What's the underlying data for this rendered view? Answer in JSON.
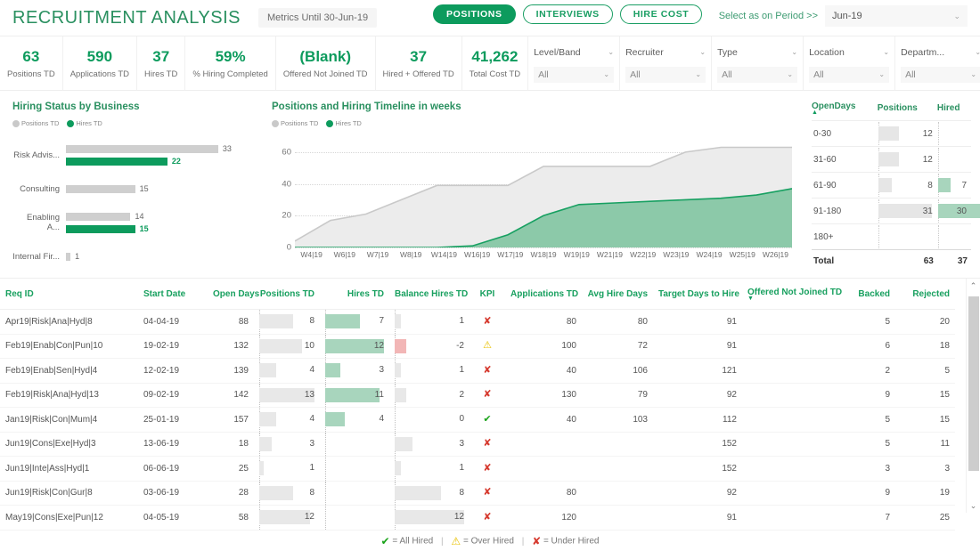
{
  "header": {
    "title": "RECRUITMENT ANALYSIS",
    "metrics_chip": "Metrics Until 30-Jun-19",
    "tabs": [
      {
        "label": "POSITIONS",
        "active": true
      },
      {
        "label": "INTERVIEWS",
        "active": false
      },
      {
        "label": "HIRE COST",
        "active": false
      }
    ],
    "period_label": "Select as on Period >>",
    "period_value": "Jun-19",
    "period_icon": "chevron-down-icon"
  },
  "kpis": [
    {
      "value": "63",
      "label": "Positions TD"
    },
    {
      "value": "590",
      "label": "Applications TD"
    },
    {
      "value": "37",
      "label": "Hires TD"
    },
    {
      "value": "59%",
      "label": "% Hiring Completed"
    },
    {
      "value": "(Blank)",
      "label": "Offered Not Joined TD"
    },
    {
      "value": "37",
      "label": "Hired + Offered TD"
    },
    {
      "value": "41,262",
      "label": "Total Cost TD"
    }
  ],
  "filters": [
    {
      "name": "Level/Band",
      "value": "All"
    },
    {
      "name": "Recruiter",
      "value": "All"
    },
    {
      "name": "Type",
      "value": "All"
    },
    {
      "name": "Location",
      "value": "All"
    },
    {
      "name": "Departm...",
      "value": "All"
    }
  ],
  "colors": {
    "brand_green": "#0d9b5d",
    "title_green": "#2a9060",
    "header_green": "#18a05f",
    "bar_gray": "#cfcfcf",
    "fill_green": "#a8d5bd",
    "fill_red": "#f2b6b6"
  },
  "chart_data": [
    {
      "type": "bar",
      "title": "Hiring Status by Business",
      "orientation": "horizontal",
      "legend": [
        "Positions TD",
        "Hires TD"
      ],
      "legend_position": "top-left",
      "categories": [
        "Risk Advis...",
        "Consulting",
        "Enabling A...",
        "Internal Fir..."
      ],
      "series": [
        {
          "name": "Positions TD",
          "values": [
            33,
            15,
            14,
            1
          ],
          "color": "#cfcfcf"
        },
        {
          "name": "Hires TD",
          "values": [
            22,
            null,
            15,
            null
          ],
          "color": "#0d9b5d"
        }
      ],
      "xlabel": "",
      "ylabel": "",
      "grid": false
    },
    {
      "type": "area",
      "title": "Positions and Hiring Timeline in weeks",
      "legend": [
        "Positions TD",
        "Hires TD"
      ],
      "legend_position": "top-left",
      "x": [
        "W4|19",
        "W6|19",
        "W7|19",
        "W8|19",
        "W14|19",
        "W16|19",
        "W17|19",
        "W18|19",
        "W19|19",
        "W21|19",
        "W22|19",
        "W23|19",
        "W24|19",
        "W25|19",
        "W26|19"
      ],
      "series": [
        {
          "name": "Positions TD",
          "values": [
            4,
            17,
            21,
            30,
            39,
            39,
            39,
            51,
            51,
            51,
            51,
            60,
            63,
            63,
            63
          ],
          "color": "#e8e8e8"
        },
        {
          "name": "Hires TD",
          "values": [
            0,
            0,
            0,
            0,
            0,
            1,
            8,
            20,
            27,
            28,
            29,
            30,
            31,
            33,
            37
          ],
          "color": "#7cc1a0"
        }
      ],
      "ylim": [
        0,
        70
      ],
      "yticks": [
        0,
        20,
        40,
        60
      ],
      "xlabel": "",
      "ylabel": "",
      "grid": true
    },
    {
      "type": "table",
      "title": "OpenDays matrix",
      "columns": [
        "OpenDays",
        "Positions",
        "Hired"
      ],
      "sort_column": "OpenDays",
      "sort_direction": "asc",
      "rows": [
        {
          "bucket": "0-30",
          "positions": "12",
          "hired": ""
        },
        {
          "bucket": "31-60",
          "positions": "12",
          "hired": ""
        },
        {
          "bucket": "61-90",
          "positions": "8",
          "hired": "7"
        },
        {
          "bucket": "91-180",
          "positions": "31",
          "hired": "30"
        },
        {
          "bucket": "180+",
          "positions": "",
          "hired": ""
        }
      ],
      "total_row": {
        "bucket": "Total",
        "positions": "63",
        "hired": "37"
      },
      "positions_max": 31,
      "hired_max": 30
    }
  ],
  "table": {
    "columns": [
      {
        "key": "req_id",
        "label": "Req ID",
        "align": "l"
      },
      {
        "key": "start_date",
        "label": "Start Date",
        "align": "l"
      },
      {
        "key": "open_days",
        "label": "Open Days",
        "align": "r"
      },
      {
        "key": "positions",
        "label": "Positions TD",
        "align": "r"
      },
      {
        "key": "hires",
        "label": "Hires TD",
        "align": "r"
      },
      {
        "key": "balance",
        "label": "Balance Hires TD",
        "align": "r"
      },
      {
        "key": "kpi",
        "label": "KPI",
        "align": "c"
      },
      {
        "key": "apps",
        "label": "Applications TD",
        "align": "r"
      },
      {
        "key": "avg_hire",
        "label": "Avg Hire Days",
        "align": "r"
      },
      {
        "key": "target",
        "label": "Target Days to Hire",
        "align": "r"
      },
      {
        "key": "onj",
        "label": "Offered Not Joined TD",
        "align": "r"
      },
      {
        "key": "backed",
        "label": "Backed",
        "align": "r"
      },
      {
        "key": "rejected",
        "label": "Rejected",
        "align": "r"
      }
    ],
    "sort_column": "Offered Not Joined TD",
    "rows": [
      {
        "req_id": "Apr19|Risk|Ana|Hyd|8",
        "start_date": "04-04-19",
        "open_days": "88",
        "positions": "8",
        "hires": "7",
        "balance": "1",
        "kpi": "under",
        "apps": "80",
        "avg_hire": "80",
        "target": "91",
        "onj": "",
        "backed": "5",
        "rejected": "20"
      },
      {
        "req_id": "Feb19|Enab|Con|Pun|10",
        "start_date": "19-02-19",
        "open_days": "132",
        "positions": "10",
        "hires": "12",
        "balance": "-2",
        "kpi": "over",
        "apps": "100",
        "avg_hire": "72",
        "target": "91",
        "onj": "",
        "backed": "6",
        "rejected": "18"
      },
      {
        "req_id": "Feb19|Enab|Sen|Hyd|4",
        "start_date": "12-02-19",
        "open_days": "139",
        "positions": "4",
        "hires": "3",
        "balance": "1",
        "kpi": "under",
        "apps": "40",
        "avg_hire": "106",
        "target": "121",
        "onj": "",
        "backed": "2",
        "rejected": "5"
      },
      {
        "req_id": "Feb19|Risk|Ana|Hyd|13",
        "start_date": "09-02-19",
        "open_days": "142",
        "positions": "13",
        "hires": "11",
        "balance": "2",
        "kpi": "under",
        "apps": "130",
        "avg_hire": "79",
        "target": "92",
        "onj": "",
        "backed": "9",
        "rejected": "15"
      },
      {
        "req_id": "Jan19|Risk|Con|Mum|4",
        "start_date": "25-01-19",
        "open_days": "157",
        "positions": "4",
        "hires": "4",
        "balance": "0",
        "kpi": "all",
        "apps": "40",
        "avg_hire": "103",
        "target": "112",
        "onj": "",
        "backed": "5",
        "rejected": "15"
      },
      {
        "req_id": "Jun19|Cons|Exe|Hyd|3",
        "start_date": "13-06-19",
        "open_days": "18",
        "positions": "3",
        "hires": "",
        "balance": "3",
        "kpi": "under",
        "apps": "",
        "avg_hire": "",
        "target": "152",
        "onj": "",
        "backed": "5",
        "rejected": "11"
      },
      {
        "req_id": "Jun19|Inte|Ass|Hyd|1",
        "start_date": "06-06-19",
        "open_days": "25",
        "positions": "1",
        "hires": "",
        "balance": "1",
        "kpi": "under",
        "apps": "",
        "avg_hire": "",
        "target": "152",
        "onj": "",
        "backed": "3",
        "rejected": "3"
      },
      {
        "req_id": "Jun19|Risk|Con|Gur|8",
        "start_date": "03-06-19",
        "open_days": "28",
        "positions": "8",
        "hires": "",
        "balance": "8",
        "kpi": "under",
        "apps": "80",
        "avg_hire": "",
        "target": "92",
        "onj": "",
        "backed": "9",
        "rejected": "19"
      },
      {
        "req_id": "May19|Cons|Exe|Pun|12",
        "start_date": "04-05-19",
        "open_days": "58",
        "positions": "12",
        "hires": "",
        "balance": "12",
        "kpi": "under",
        "apps": "120",
        "avg_hire": "",
        "target": "91",
        "onj": "",
        "backed": "7",
        "rejected": "25"
      }
    ],
    "bars_max": {
      "positions": 13,
      "hires": 12,
      "balance": 12
    },
    "scrollbar": {
      "up_icon": "chevron-up-icon",
      "down_icon": "chevron-down-icon"
    }
  },
  "footer": {
    "all_hired": "= All Hired",
    "over_hired": "= Over Hired",
    "under_hired": "= Under Hired",
    "separator": "|"
  }
}
